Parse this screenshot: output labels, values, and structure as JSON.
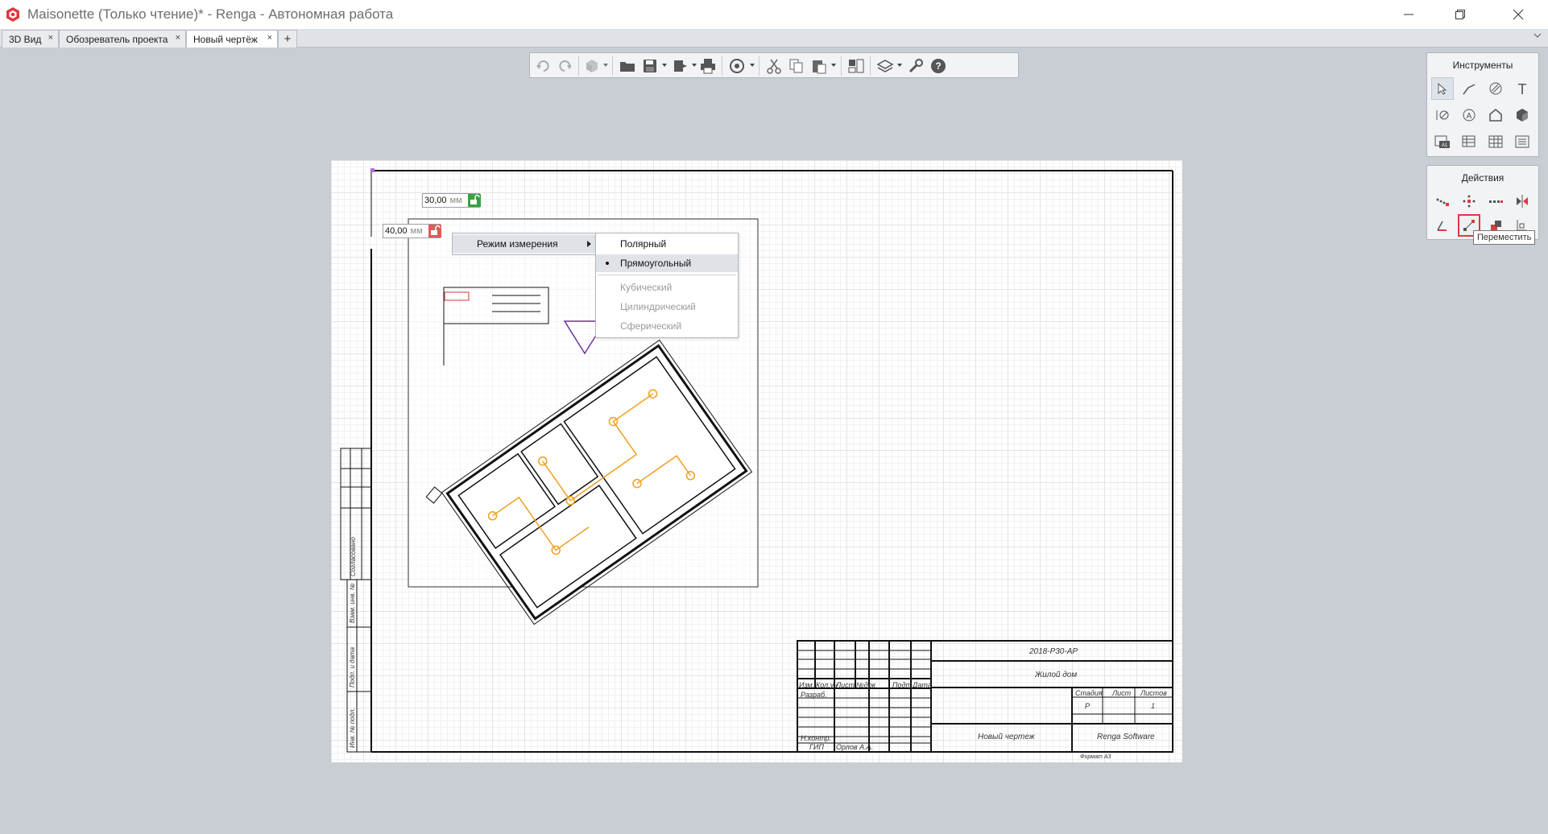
{
  "window": {
    "title": "Maisonette (Только чтение)* - Renga - Автономная работа",
    "minimize_icon": "minimize-icon",
    "restore_icon": "restore-icon",
    "close_icon": "close-icon"
  },
  "tabs": [
    {
      "label": "3D Вид",
      "close": "×"
    },
    {
      "label": "Обозреватель проекта",
      "close": "×"
    },
    {
      "label": "Новый чертёж",
      "close": "×",
      "active": true
    }
  ],
  "tab_add": "+",
  "toolbar": {
    "icons": [
      "undo-icon",
      "redo-icon",
      "3d-box-icon",
      "open-folder-icon",
      "save-icon",
      "export-icon",
      "print-icon",
      "orbit-icon",
      "cut-icon",
      "copy-icon",
      "paste-icon",
      "views-icon",
      "layers-icon",
      "wrench-icon",
      "help-icon"
    ]
  },
  "panels": {
    "tools_title": "Инструменты",
    "actions_title": "Действия"
  },
  "tooltip": "Переместить",
  "dimensions": {
    "dx_value": "30,00",
    "dy_value": "40,00",
    "unit": "мм"
  },
  "context_menu": {
    "item": "Режим измерения",
    "submenu": [
      {
        "label": "Полярный",
        "state": "normal"
      },
      {
        "label": "Прямоугольный",
        "state": "selected"
      },
      {
        "label": "Кубический",
        "state": "disabled"
      },
      {
        "label": "Цилиндрический",
        "state": "disabled"
      },
      {
        "label": "Сферический",
        "state": "disabled"
      }
    ]
  },
  "title_block": {
    "code": "2018-Р30-АР",
    "name": "Жилой дом",
    "cols": [
      "Изм.",
      "Кол.уч",
      "Лист",
      "№док",
      "Подп.",
      "Дата"
    ],
    "role_dev": "Разраб.",
    "role_norm": "Н.контр.",
    "role_gip": "ГИП",
    "gip_name": "Орлов А.А.",
    "stage_h": "Стадия",
    "sheet_h": "Лист",
    "sheets_h": "Листов",
    "stage": "Р",
    "sheets": "1",
    "drawing": "Новый чертеж",
    "company": "Renga Software",
    "format": "Формат А3",
    "side_labels": [
      "Взам. инв. №",
      "Подп. и дата",
      "Инв. № подл.",
      "Согласовано"
    ]
  },
  "colors": {
    "accent_red": "#e0383e",
    "lock_green": "#3aa041",
    "lock_red": "#e05a5a",
    "electrical": "#f0a01e"
  }
}
